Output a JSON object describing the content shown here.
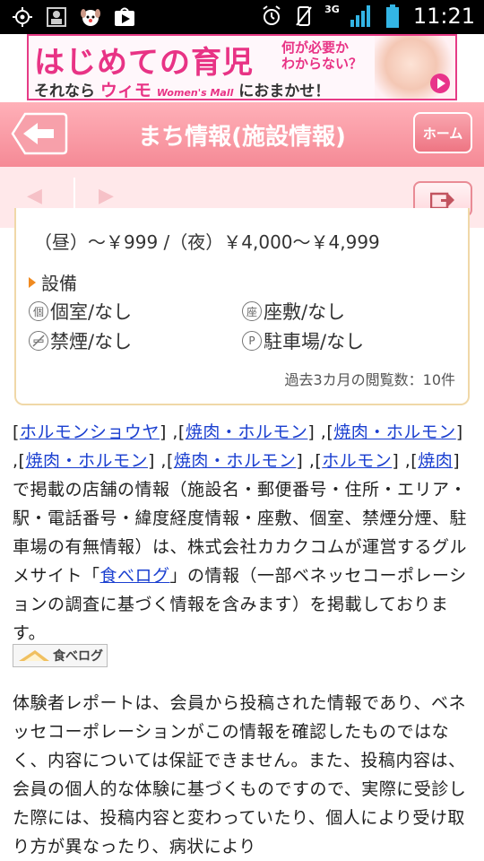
{
  "status_bar": {
    "time": "11:21",
    "network": "3G",
    "icons": [
      "location-icon",
      "contact-icon",
      "puppy-app-icon",
      "play-store-icon",
      "alarm-icon",
      "vibrate-icon",
      "signal-icon",
      "battery-icon"
    ]
  },
  "banner": {
    "line1": "はじめての育児",
    "side_line1": "何が必要か",
    "side_line2": "わからない？",
    "line2_pre": "それなら",
    "brand": "ウィモ",
    "brand_sub": "Women's Mall",
    "line2_post": "におまかせ！"
  },
  "header": {
    "title": "まち情報(施設情報)",
    "home_label": "ホーム"
  },
  "nav": {
    "prev_symbol": "◀",
    "next_symbol": "▶"
  },
  "card": {
    "price": "（昼）～￥999 /（夜）￥4,000～￥4,999",
    "equipment_heading": "設備",
    "facilities": {
      "private_room": {
        "icon": "個",
        "text": "個室/なし"
      },
      "tatami": {
        "icon": "座",
        "text": "座敷/なし"
      },
      "no_smoking": {
        "icon": "",
        "text": "禁煙/なし"
      },
      "parking": {
        "icon": "P",
        "text": "駐車場/なし"
      }
    },
    "views": "過去3カ月の閲覧数：10件"
  },
  "description": {
    "link1": "ホルモンショウヤ",
    "link2": "焼肉・ホルモン",
    "link3": "焼肉・ホルモン",
    "link4": "焼肉・ホルモン",
    "link5": "焼肉・ホルモン",
    "link6": "ホルモン",
    "link7": "焼肉",
    "body1": " で掲載の店舗の情報（施設名・郵便番号・住所・エリア・駅・電話番号・緯度経度情報・座敷、個室、禁煙分煙、駐車場の有無情報）は、株式会社カカクコムが運営するグルメサイト「",
    "tabelog_link": "食べログ",
    "body2": "」の情報（一部ベネッセコーポレーションの調査に基づく情報を含みます）を掲載しております。"
  },
  "tabelog_logo": "食べログ",
  "report": "体験者レポートは、会員から投稿された情報であり、ベネッセコーポレーションがこの情報を確認したものではなく、内容については保証できません。また、投稿内容は、会員の個人的な体験に基づくものですので、実際に受診した際には、投稿内容と変わっていたり、個人により受け取り方が異なったり、病状により",
  "colors": {
    "header_pink": "#f58a96",
    "banner_pink": "#e83385",
    "link_blue": "#1a3fd0",
    "card_border": "#f0d8a8"
  }
}
